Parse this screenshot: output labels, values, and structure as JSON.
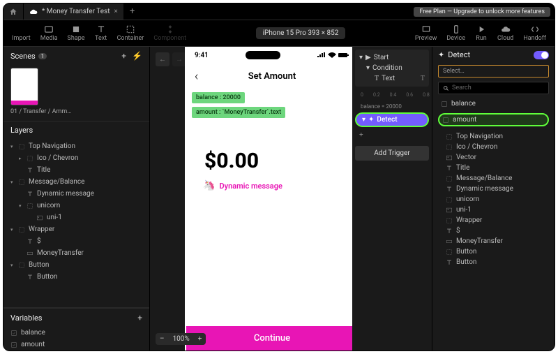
{
  "tab": {
    "title": "* Money Transfer Test"
  },
  "banner": "Free Plan — Upgrade to unlock more features",
  "toolbar": {
    "import": "Import",
    "media": "Media",
    "shape": "Shape",
    "text": "Text",
    "container": "Container",
    "component": "Component",
    "preview": "Preview",
    "device": "Device",
    "run": "Run",
    "cloud": "Cloud",
    "handoff": "Handoff"
  },
  "device": "iPhone 15 Pro  393 × 852",
  "scenes": {
    "title": "Scenes",
    "count": "1",
    "thumb_label": "01 / Transfer / Amm…"
  },
  "layers": {
    "title": "Layers",
    "items": [
      {
        "l": "Top Navigation",
        "d": 0,
        "a": "▾",
        "i": "frame"
      },
      {
        "l": "Ico / Chevron",
        "d": 1,
        "a": "▸",
        "i": "frame"
      },
      {
        "l": "Title",
        "d": 1,
        "a": "",
        "i": "text"
      },
      {
        "l": "Message/Balance",
        "d": 0,
        "a": "▾",
        "i": "frame"
      },
      {
        "l": "Dynamic message",
        "d": 1,
        "a": "",
        "i": "text"
      },
      {
        "l": "unicorn",
        "d": 1,
        "a": "▾",
        "i": "frame"
      },
      {
        "l": "uni-1",
        "d": 2,
        "a": "",
        "i": "image"
      },
      {
        "l": "Wrapper",
        "d": 0,
        "a": "▾",
        "i": "frame"
      },
      {
        "l": "$",
        "d": 1,
        "a": "",
        "i": "text"
      },
      {
        "l": "MoneyTransfer",
        "d": 1,
        "a": "",
        "i": "input"
      },
      {
        "l": "Button",
        "d": 0,
        "a": "▾",
        "i": "frame"
      },
      {
        "l": "Button",
        "d": 1,
        "a": "",
        "i": "text"
      }
    ]
  },
  "variables": {
    "title": "Variables",
    "items": [
      "balance",
      "amount"
    ]
  },
  "canvas": {
    "time": "9:41",
    "screen_title": "Set Amount",
    "chip1": "balance : 20000",
    "chip2": "amount : `MoneyTransfer`.text",
    "amount": "$0.00",
    "dynamic": "Dynamic message",
    "cta": "Continue",
    "zoom": "100%"
  },
  "interact": {
    "start": "Start",
    "condition": "Condition",
    "text": "Text",
    "detect": "Detect",
    "add_trigger": "Add Trigger",
    "ruler": [
      "0",
      "0.2",
      "0.4",
      "0.6",
      "0.8"
    ],
    "balance_note": "balance = 20000"
  },
  "props": {
    "title": "Detect",
    "select": "Select…",
    "search": "Search",
    "var1": "balance",
    "var2": "amount",
    "tree": [
      {
        "l": "Top Navigation",
        "d": 0,
        "i": "frame"
      },
      {
        "l": "Ico / Chevron",
        "d": 1,
        "i": "frame"
      },
      {
        "l": "Vector",
        "d": 2,
        "i": "image"
      },
      {
        "l": "Title",
        "d": 1,
        "i": "text"
      },
      {
        "l": "Message/Balance",
        "d": 0,
        "i": "frame"
      },
      {
        "l": "Dynamic message",
        "d": 1,
        "i": "text"
      },
      {
        "l": "unicorn",
        "d": 1,
        "i": "frame"
      },
      {
        "l": "uni-1",
        "d": 2,
        "i": "image"
      },
      {
        "l": "Wrapper",
        "d": 0,
        "i": "frame"
      },
      {
        "l": "$",
        "d": 1,
        "i": "text"
      },
      {
        "l": "MoneyTransfer",
        "d": 1,
        "i": "input"
      },
      {
        "l": "Button",
        "d": 0,
        "i": "frame"
      },
      {
        "l": "Button",
        "d": 1,
        "i": "text"
      }
    ]
  }
}
